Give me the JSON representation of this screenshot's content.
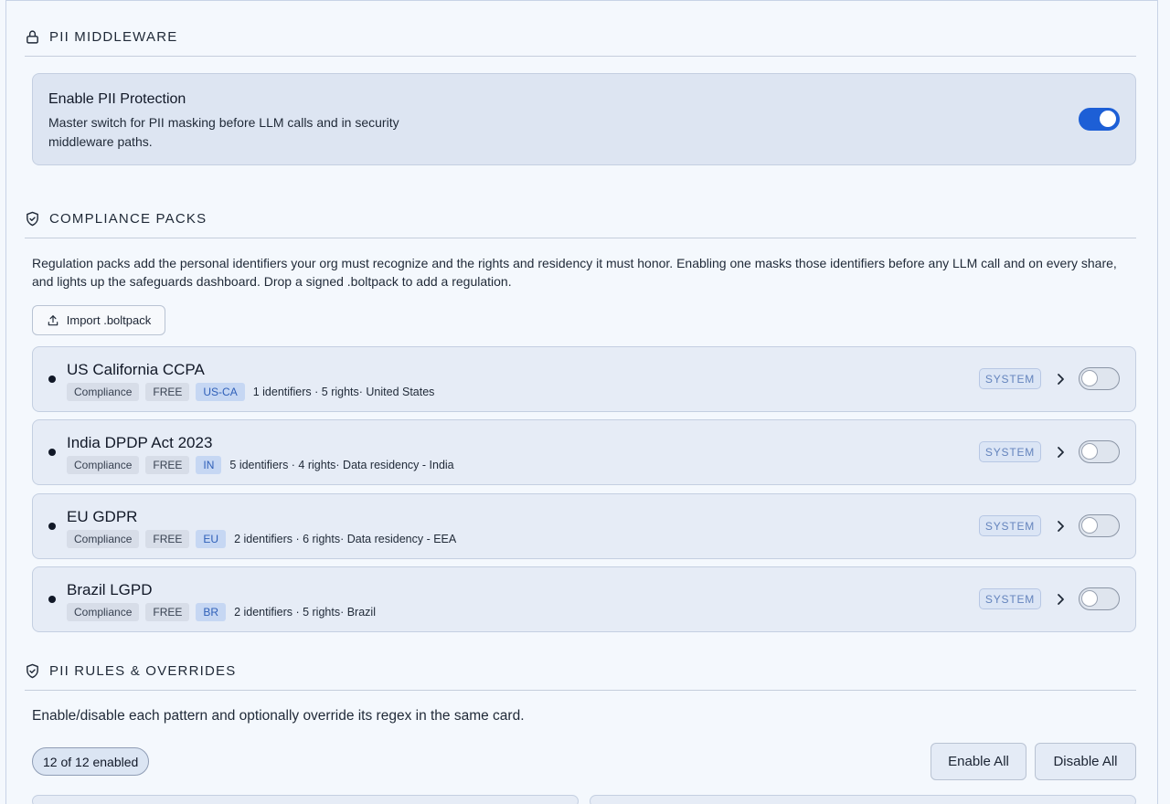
{
  "pii_middleware": {
    "section_title": "PII MIDDLEWARE",
    "icon": "lock-icon",
    "enable_title": "Enable PII Protection",
    "enable_desc": "Master switch for PII masking before LLM calls and in security middleware paths.",
    "enabled": true
  },
  "compliance": {
    "section_title": "COMPLIANCE PACKS",
    "icon": "shield-check-icon",
    "intro": "Regulation packs add the personal identifiers your org must recognize and the rights and residency it must honor. Enabling one masks those identifiers before any LLM call and on every share, and lights up the safeguards dashboard. Drop a signed .boltpack to add a regulation.",
    "import_label": "Import .boltpack",
    "packs": [
      {
        "name": "US California CCPA",
        "type": "Compliance",
        "tier": "FREE",
        "region": "US-CA",
        "meta": "1 identifiers · 5 rights· United States",
        "badge": "SYSTEM",
        "enabled": false
      },
      {
        "name": "India DPDP Act 2023",
        "type": "Compliance",
        "tier": "FREE",
        "region": "IN",
        "meta": "5 identifiers · 4 rights· Data residency - India",
        "badge": "SYSTEM",
        "enabled": false
      },
      {
        "name": "EU GDPR",
        "type": "Compliance",
        "tier": "FREE",
        "region": "EU",
        "meta": "2 identifiers · 6 rights· Data residency - EEA",
        "badge": "SYSTEM",
        "enabled": false
      },
      {
        "name": "Brazil LGPD",
        "type": "Compliance",
        "tier": "FREE",
        "region": "BR",
        "meta": "2 identifiers · 5 rights· Brazil",
        "badge": "SYSTEM",
        "enabled": false
      }
    ]
  },
  "rules": {
    "section_title": "PII RULES & OVERRIDES",
    "icon": "shield-check-icon",
    "desc": "Enable/disable each pattern and optionally override its regex in the same card.",
    "count": "12 of 12 enabled",
    "enable_all": "Enable All",
    "disable_all": "Disable All"
  },
  "colors": {
    "accent": "#1d5fd6",
    "background": "#f4f8fd",
    "card": "#e6ecf6"
  }
}
